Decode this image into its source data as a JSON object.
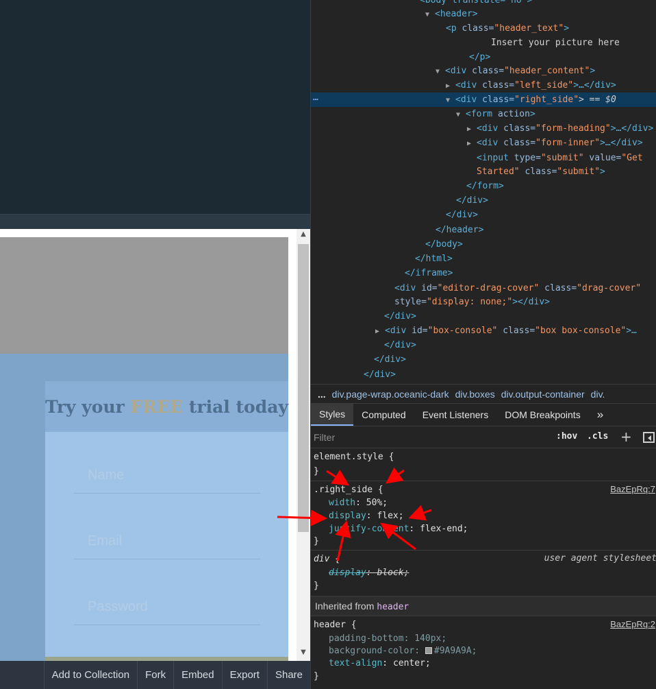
{
  "preview": {
    "heading_pre": "Try your ",
    "heading_free": "FREE",
    "heading_post": " trial today",
    "name_placeholder": "Name",
    "email_placeholder": "Email",
    "password_placeholder": "Password",
    "scroll_up": "▲",
    "scroll_down": "▼"
  },
  "footer": {
    "buttons": [
      "Add to Collection",
      "Fork",
      "Embed",
      "Export",
      "Share"
    ]
  },
  "dom": {
    "l0": "<body translate=\"no\">",
    "l1": "<header>",
    "l2_tag": "<p ",
    "l2_attr": "class=",
    "l2_val": "\"header_text\"",
    "l2_close": ">",
    "l3": "Insert your picture here",
    "l4": "</p>",
    "l5_val": "\"header_content\"",
    "l6_val": "\"left_side\"",
    "l6_tail": ">…</div>",
    "l7_val": "\"right_side\"",
    "l7_tail": "> == $0",
    "l8_tag": "<form ",
    "l8_attr": "action",
    "l8_close": ">",
    "l9_val": "\"form-heading\"",
    "l9_tail": ">…</div>",
    "l10_val": "\"form-inner\"",
    "l10_tail": ">…</div>",
    "l11_a": "type=",
    "l11_v": "\"submit\"",
    "l11_b": " value=",
    "l11_v2": "\"Get",
    "l12_v": "Started\"",
    "l12_b": " class=",
    "l12_v2": "\"submit\"",
    "l12_close": ">",
    "l13": "</form>",
    "l14": "</div>",
    "l15": "</div>",
    "l16": "</header>",
    "l17": "</body>",
    "l18": "</html>",
    "l19": "</iframe>",
    "l20_a": "id=",
    "l20_v": "\"editor-drag-cover\"",
    "l20_b": " class=",
    "l20_v2": "\"drag-cover\"",
    "l21_a": "style=",
    "l21_v": "\"display: none;\"",
    "l21_close": "></div>",
    "l22": "</div>",
    "l23_a": "id=",
    "l23_v": "\"box-console\"",
    "l23_b": " class=",
    "l23_v2": "\"box box-console\"",
    "l23_tail": ">…",
    "l24": "</div>",
    "l25": "</div>",
    "l26": "</div>",
    "div_open": "<div ",
    "input_open": "<input ",
    "class_attr": "class=",
    "dots": "…"
  },
  "breadcrumbs": {
    "more": "...",
    "items": [
      "div.page-wrap.oceanic-dark",
      "div.boxes",
      "div.output-container",
      "div."
    ]
  },
  "tabs": [
    "Styles",
    "Computed",
    "Event Listeners",
    "DOM Breakpoints",
    "»"
  ],
  "filter": {
    "placeholder": "Filter",
    "hov": ":hov",
    "cls": ".cls",
    "plus": "+"
  },
  "styles": {
    "element_style": "element.style {",
    "close": "}",
    "right_side": {
      "selector": ".right_side {",
      "source": "BazEpRq:7",
      "props": [
        {
          "name": "width",
          "value": "50%;"
        },
        {
          "name": "display",
          "value": "flex;"
        },
        {
          "name": "justify-content",
          "value": "flex-end;"
        }
      ]
    },
    "div_rule": {
      "selector": "div {",
      "source": "user agent stylesheet",
      "prop_name": "display",
      "prop_value": "block;"
    },
    "inherited_label": "Inherited from ",
    "inherited_tag": "header",
    "header_rule": {
      "selector": "header {",
      "source": "BazEpRq:2",
      "props": [
        {
          "name": "padding-bottom",
          "value": "140px;"
        },
        {
          "name": "background-color",
          "value": "#9A9A9A;"
        },
        {
          "name": "text-align",
          "value": "center;"
        }
      ]
    }
  },
  "colors": {
    "annotation_arrow": "#ff0000",
    "selected_row": "#0e3a5c",
    "header_bg": "#9a9a9a"
  }
}
